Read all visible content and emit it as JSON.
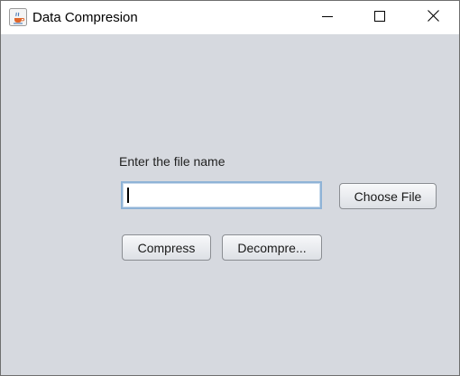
{
  "window": {
    "title": "Data Compresion",
    "icons": {
      "app": "java-coffee-cup-icon",
      "minimize": "minimize-icon",
      "maximize": "maximize-icon",
      "close": "close-icon"
    }
  },
  "form": {
    "filename_label": "Enter the file name",
    "filename_value": "",
    "choose_file_label": "Choose File",
    "compress_label": "Compress",
    "decompress_label": "Decompre..."
  },
  "colors": {
    "content_background": "#d6d9df",
    "titlebar_background": "#ffffff",
    "field_focus_border": "#8fb3d6"
  }
}
